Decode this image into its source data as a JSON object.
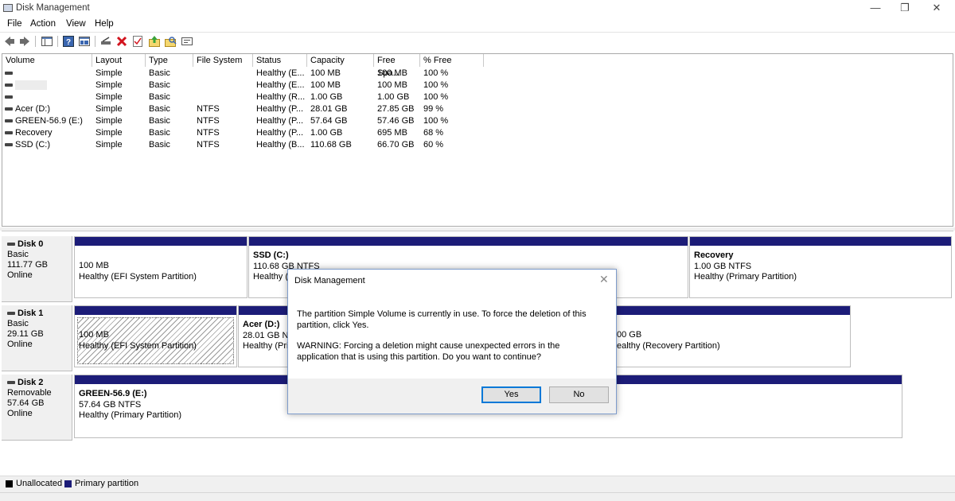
{
  "window": {
    "title": "Disk Management",
    "minimize": "—",
    "maximize": "❐",
    "close": "✕"
  },
  "menu": [
    "File",
    "Action",
    "View",
    "Help"
  ],
  "toolbar": {
    "icons": [
      "back-icon",
      "forward-icon",
      "console-tree-icon",
      "help-icon",
      "disk-list-icon",
      "connect-icon",
      "delete-icon",
      "properties-icon",
      "import-icon",
      "rescan-icon",
      "settings-icon"
    ]
  },
  "volumes": {
    "columns": [
      "Volume",
      "Layout",
      "Type",
      "File System",
      "Status",
      "Capacity",
      "Free Spa...",
      "% Free"
    ],
    "rows": [
      {
        "volume": "",
        "layout": "Simple",
        "type": "Basic",
        "fs": "",
        "status": "Healthy (E...",
        "capacity": "100 MB",
        "free": "100 MB",
        "pct": "100 %"
      },
      {
        "volume": "",
        "layout": "Simple",
        "type": "Basic",
        "fs": "",
        "status": "Healthy (E...",
        "capacity": "100 MB",
        "free": "100 MB",
        "pct": "100 %"
      },
      {
        "volume": "",
        "layout": "Simple",
        "type": "Basic",
        "fs": "",
        "status": "Healthy (R...",
        "capacity": "1.00 GB",
        "free": "1.00 GB",
        "pct": "100 %"
      },
      {
        "volume": "Acer (D:)",
        "layout": "Simple",
        "type": "Basic",
        "fs": "NTFS",
        "status": "Healthy (P...",
        "capacity": "28.01 GB",
        "free": "27.85 GB",
        "pct": "99 %"
      },
      {
        "volume": "GREEN-56.9 (E:)",
        "layout": "Simple",
        "type": "Basic",
        "fs": "NTFS",
        "status": "Healthy (P...",
        "capacity": "57.64 GB",
        "free": "57.46 GB",
        "pct": "100 %"
      },
      {
        "volume": "Recovery",
        "layout": "Simple",
        "type": "Basic",
        "fs": "NTFS",
        "status": "Healthy (P...",
        "capacity": "1.00 GB",
        "free": "695 MB",
        "pct": "68 %"
      },
      {
        "volume": "SSD (C:)",
        "layout": "Simple",
        "type": "Basic",
        "fs": "NTFS",
        "status": "Healthy (B...",
        "capacity": "110.68 GB",
        "free": "66.70 GB",
        "pct": "60 %"
      }
    ]
  },
  "disks": [
    {
      "name": "Disk 0",
      "type": "Basic",
      "size": "111.77 GB",
      "state": "Online",
      "partitions": [
        {
          "title": "",
          "line1": "100 MB",
          "line2": "Healthy (EFI System Partition)"
        },
        {
          "title": "SSD  (C:)",
          "line1": "110.68 GB NTFS",
          "line2": "Healthy (B"
        },
        {
          "title": "Recovery",
          "line1": "1.00 GB NTFS",
          "line2": "Healthy (Primary Partition)"
        }
      ]
    },
    {
      "name": "Disk 1",
      "type": "Basic",
      "size": "29.11 GB",
      "state": "Online",
      "partitions": [
        {
          "title": "",
          "line1": "100 MB",
          "line2": "Healthy (EFI System Partition)"
        },
        {
          "title": "Acer  (D:)",
          "line1": "28.01 GB NT",
          "line2": "Healthy (Pri"
        },
        {
          "title": "",
          "line1": "00 GB",
          "line2": "ealthy (Recovery Partition)"
        }
      ]
    },
    {
      "name": "Disk 2",
      "type": "Removable",
      "size": "57.64 GB",
      "state": "Online",
      "partitions": [
        {
          "title": "GREEN-56.9  (E:)",
          "line1": "57.64 GB NTFS",
          "line2": "Healthy (Primary Partition)"
        }
      ]
    }
  ],
  "legend": [
    {
      "label": "Unallocated",
      "color": "#000000"
    },
    {
      "label": "Primary partition",
      "color": "#1c1c78"
    }
  ],
  "dialog": {
    "title": "Disk Management",
    "message1": "The partition  Simple Volume is currently in use. To force the deletion of this partition, click Yes.",
    "message2": "WARNING: Forcing a deletion might cause unexpected errors in the application that is using this partition. Do you want to continue?",
    "yes": "Yes",
    "no": "No"
  },
  "colors": {
    "partition_bar": "#1c1c78",
    "accent": "#0078d7"
  }
}
